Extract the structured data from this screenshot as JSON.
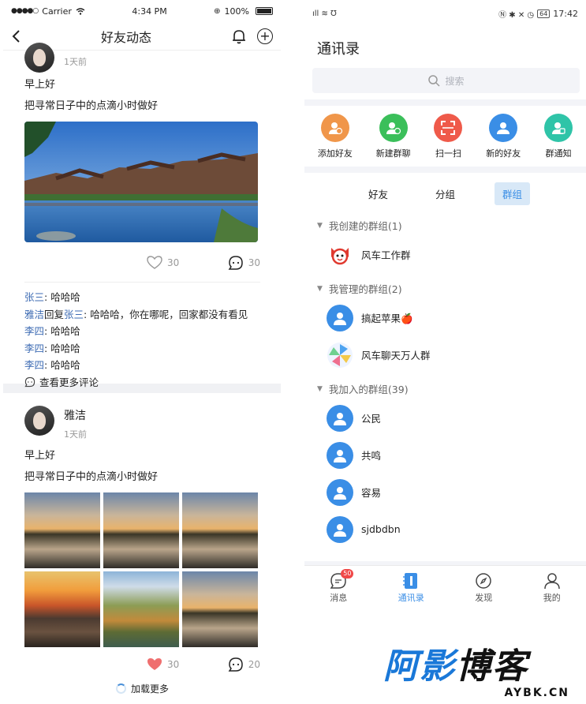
{
  "left": {
    "status": {
      "carrier": "Carrier",
      "time": "4:34 PM",
      "battery": "100%"
    },
    "nav": {
      "title": "好友动态"
    },
    "post1": {
      "time": "1天前",
      "greeting": "早上好",
      "text": "把寻常日子中的点滴小时做好",
      "likes": "30",
      "comments_count": "30",
      "comments": [
        {
          "user": "张三",
          "sep": ": ",
          "text": "哈哈哈"
        },
        {
          "user": "雅洁",
          "reply_word": "回复",
          "reply_to": "张三",
          "sep": ": ",
          "text": "哈哈哈，你在哪呢，回家都没有看见"
        },
        {
          "user": "李四",
          "sep": ": ",
          "text": "哈哈哈"
        },
        {
          "user": "李四",
          "sep": ": ",
          "text": "哈哈哈"
        },
        {
          "user": "李四",
          "sep": ": ",
          "text": "哈哈哈"
        }
      ],
      "more_comments": "查看更多评论"
    },
    "post2": {
      "name": "雅洁",
      "time": "1天前",
      "greeting": "早上好",
      "text": "把寻常日子中的点滴小时做好",
      "likes": "30",
      "comments_count": "20",
      "load_more": "加载更多"
    }
  },
  "right": {
    "status": {
      "battery": "64",
      "time": "17:42"
    },
    "title": "通讯录",
    "search_placeholder": "搜索",
    "quick": [
      {
        "label": "添加好友",
        "color": "#f0964a"
      },
      {
        "label": "新建群聊",
        "color": "#3bbf5a"
      },
      {
        "label": "扫一扫",
        "color": "#ef5a4a"
      },
      {
        "label": "新的好友",
        "color": "#3a8ee6"
      },
      {
        "label": "群通知",
        "color": "#2fc4a8"
      }
    ],
    "tabs": [
      "好友",
      "分组",
      "群组"
    ],
    "sections": {
      "created": {
        "title": "我创建的群组(1)",
        "groups": [
          "风车工作群"
        ]
      },
      "managed": {
        "title": "我管理的群组(2)",
        "groups": [
          "搞起苹果🍎",
          "风车聊天万人群"
        ]
      },
      "joined": {
        "title": "我加入的群组(39)",
        "groups": [
          "公民",
          "共鸣",
          "容易",
          "sjdbdbn"
        ]
      }
    },
    "tabbar": {
      "messages": "消息",
      "badge": "50",
      "contacts": "通讯录",
      "discover": "发现",
      "mine": "我的"
    }
  },
  "watermark": {
    "main_blue": "阿影",
    "main_dark": "博客",
    "sub": "AYBK.CN"
  }
}
